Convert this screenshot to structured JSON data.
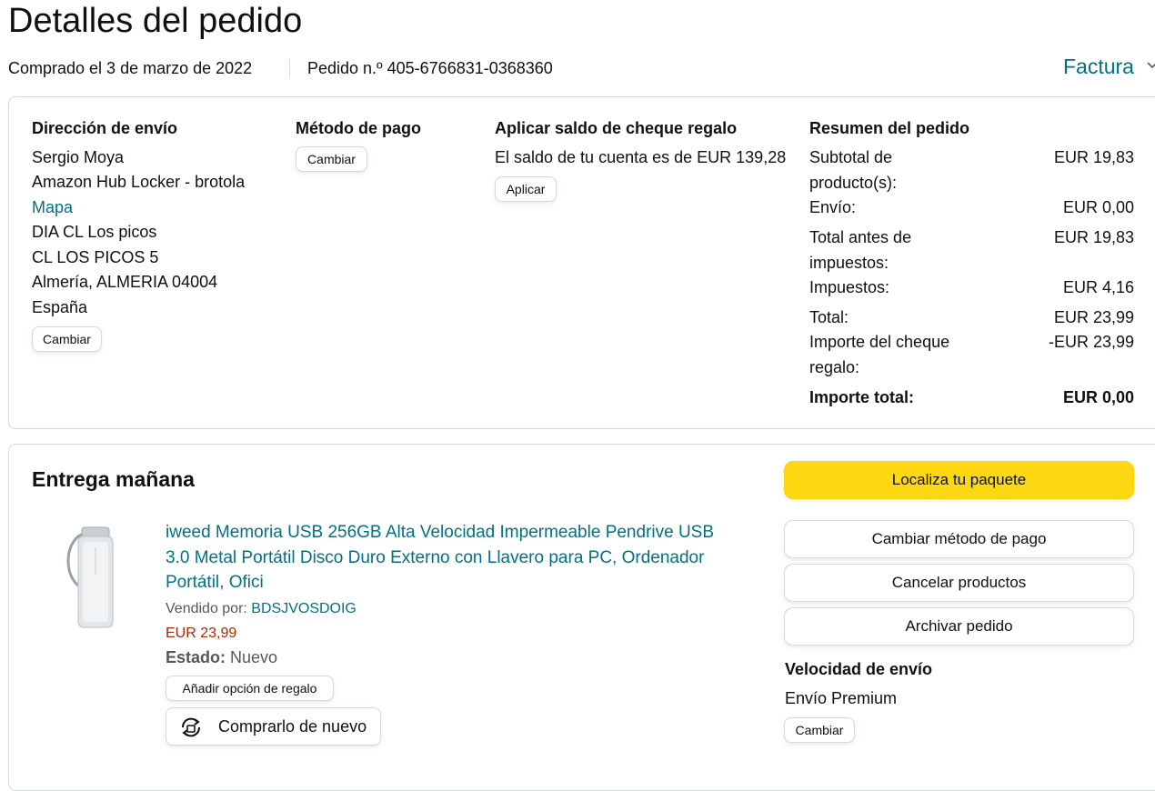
{
  "page": {
    "title": "Detalles del pedido",
    "purchase_date": "Comprado el 3 de marzo de 2022",
    "order_number": "Pedido n.º 405-6766831-0368360",
    "invoice_label": "Factura"
  },
  "shipping": {
    "header": "Dirección de envío",
    "name": "Sergio Moya",
    "locker": "Amazon Hub Locker - brotola",
    "map_link": "Mapa",
    "line1": "DIA CL Los picos",
    "line2": "CL LOS PICOS 5",
    "city": "Almería, ALMERIA 04004",
    "country": "España",
    "change_label": "Cambiar"
  },
  "payment": {
    "header": "Método de pago",
    "change_label": "Cambiar"
  },
  "gift_card": {
    "header": "Aplicar saldo de cheque regalo",
    "balance_text": "El saldo de tu cuenta es de EUR 139,28",
    "apply_label": "Aplicar"
  },
  "summary": {
    "header": "Resumen del pedido",
    "rows": [
      {
        "label": "Subtotal de producto(s):",
        "value": "EUR 19,83"
      },
      {
        "label": "Envío:",
        "value": "EUR 0,00"
      },
      {
        "label": "Total antes de impuestos:",
        "value": "EUR 19,83"
      },
      {
        "label": "Impuestos:",
        "value": "EUR 4,16"
      },
      {
        "label": "Total:",
        "value": "EUR 23,99"
      },
      {
        "label": "Importe del cheque regalo:",
        "value": "-EUR 23,99"
      }
    ],
    "grand_total_label": "Importe total:",
    "grand_total_value": "EUR 0,00"
  },
  "delivery": {
    "header": "Entrega mañana",
    "product_title": "iweed Memoria USB 256GB Alta Velocidad Impermeable Pendrive USB 3.0 Metal Portátil Disco Duro Externo con Llavero para PC, Ordenador Portátil, Ofici",
    "sold_by_label": "Vendido por: ",
    "seller": "BDSJVOSDOIG",
    "price": "EUR 23,99",
    "condition_label": "Estado:",
    "condition_value": " Nuevo",
    "gift_option_label": "Añadir opción de regalo",
    "rebuy_label": "Comprarlo de nuevo"
  },
  "actions": {
    "track": "Localiza tu paquete",
    "change_payment": "Cambiar método de pago",
    "cancel": "Cancelar productos",
    "archive": "Archivar pedido"
  },
  "shipping_speed": {
    "header": "Velocidad de envío",
    "value": "Envío Premium",
    "change_label": "Cambiar"
  },
  "colors": {
    "link": "#007185",
    "price": "#b12704",
    "primary_button": "#ffd814"
  },
  "icons": {
    "invoice_chevron": "chevron-down-icon",
    "rebuy": "rebuy-icon",
    "product_image": "usb-drive-image"
  }
}
